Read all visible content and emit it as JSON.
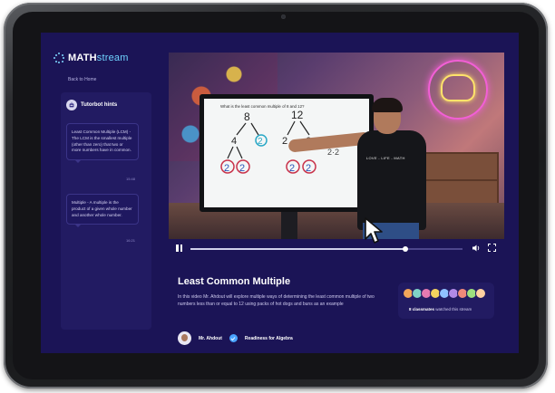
{
  "app": {
    "logo_prefix": "MATH",
    "logo_suffix": "stream",
    "back_link": "Back to Home"
  },
  "hints": {
    "title": "Tutorbot hints",
    "cards": [
      {
        "text": "Least Common Multiple (LCM) - The LCM is the smallest multiple (other than zero) that two or more numbers have in common.",
        "time": "15:48"
      },
      {
        "text": "Multiple - A multiple is the product of a given whole number and another whole number.",
        "time": "16:21"
      }
    ]
  },
  "video": {
    "whiteboard_text": "What is the least common multiple of 8 and 12?",
    "shirt_text": "LOVE - LIFE - MATH",
    "progress": 0.79
  },
  "lesson": {
    "title": "Least Common Multiple",
    "description": "In this video Mr. Ahdout will explore multiple ways of determining the least common multiple of two numbers less than or equal to 12 using packs of hot dogs and buns as an example",
    "teacher_name": "Mr. Ahdout",
    "course_tag": "Readiness for Algebra"
  },
  "classmates": {
    "count": "8 classmates",
    "suffix": " watched this stream",
    "avatar_colors": [
      "#f2a65a",
      "#7fd3c7",
      "#e57ab1",
      "#f4d35e",
      "#8fc1ff",
      "#b28ae8",
      "#f08a7a",
      "#9ee07f",
      "#ffd1a1"
    ]
  },
  "colors": {
    "screen_bg": "#1b1456",
    "panel_bg": "#221b62",
    "accent": "#6fd3ff"
  }
}
